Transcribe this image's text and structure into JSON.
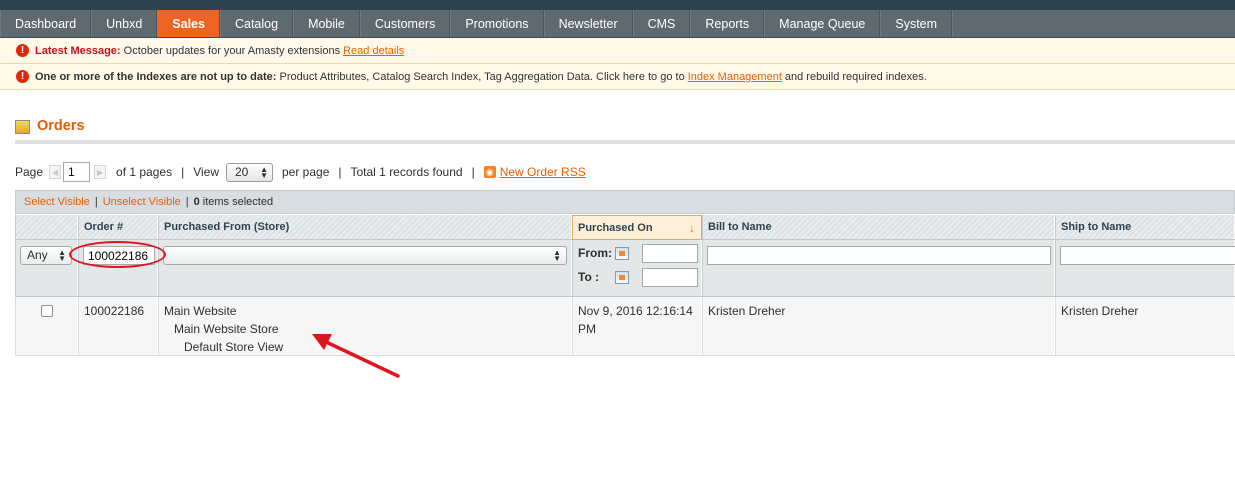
{
  "nav": {
    "items": [
      {
        "label": "Dashboard",
        "active": false
      },
      {
        "label": "Unbxd",
        "active": false
      },
      {
        "label": "Sales",
        "active": true
      },
      {
        "label": "Catalog",
        "active": false
      },
      {
        "label": "Mobile",
        "active": false
      },
      {
        "label": "Customers",
        "active": false
      },
      {
        "label": "Promotions",
        "active": false
      },
      {
        "label": "Newsletter",
        "active": false
      },
      {
        "label": "CMS",
        "active": false
      },
      {
        "label": "Reports",
        "active": false
      },
      {
        "label": "Manage Queue",
        "active": false
      },
      {
        "label": "System",
        "active": false
      }
    ]
  },
  "messages": {
    "latest": {
      "label": "Latest Message:",
      "text": "October updates for your Amasty extensions",
      "link": "Read details"
    },
    "index": {
      "label": "One or more of the Indexes are not up to date:",
      "text": "Product Attributes, Catalog Search Index, Tag Aggregation Data. Click here to go to",
      "link": "Index Management",
      "suffix": "and rebuild required indexes."
    }
  },
  "page": {
    "title": "Orders"
  },
  "pager": {
    "page_label": "Page",
    "page_value": "1",
    "of_pages": "of 1 pages",
    "view_label": "View",
    "per_page_value": "20",
    "per_page_label": "per page",
    "total": "Total 1 records found",
    "rss_label": "New Order RSS"
  },
  "massaction": {
    "select_visible": "Select Visible",
    "unselect_visible": "Unselect Visible",
    "count": "0",
    "selected_label": "items selected"
  },
  "grid": {
    "columns": [
      "",
      "Order #",
      "Purchased From (Store)",
      "Purchased On",
      "Bill to Name",
      "Ship to Name"
    ],
    "filters": {
      "massaction_any": "Any",
      "order_number": "100022186",
      "store": "",
      "from_label": "From:",
      "to_label": "To :",
      "from_value": "",
      "to_value": "",
      "bill_to": "",
      "ship_to": ""
    },
    "rows": [
      {
        "order_number": "100022186",
        "store_website": "Main Website",
        "store_group": "Main Website Store",
        "store_view": "Default Store View",
        "purchased_on_line1": "Nov 9, 2016 12:16:14",
        "purchased_on_line2": "PM",
        "bill_to_name": "Kristen Dreher",
        "ship_to_name": "Kristen Dreher"
      }
    ]
  },
  "colors": {
    "accent": "#ef6322",
    "nav_bg": "#5e6a70",
    "annotation": "#e0141e"
  }
}
